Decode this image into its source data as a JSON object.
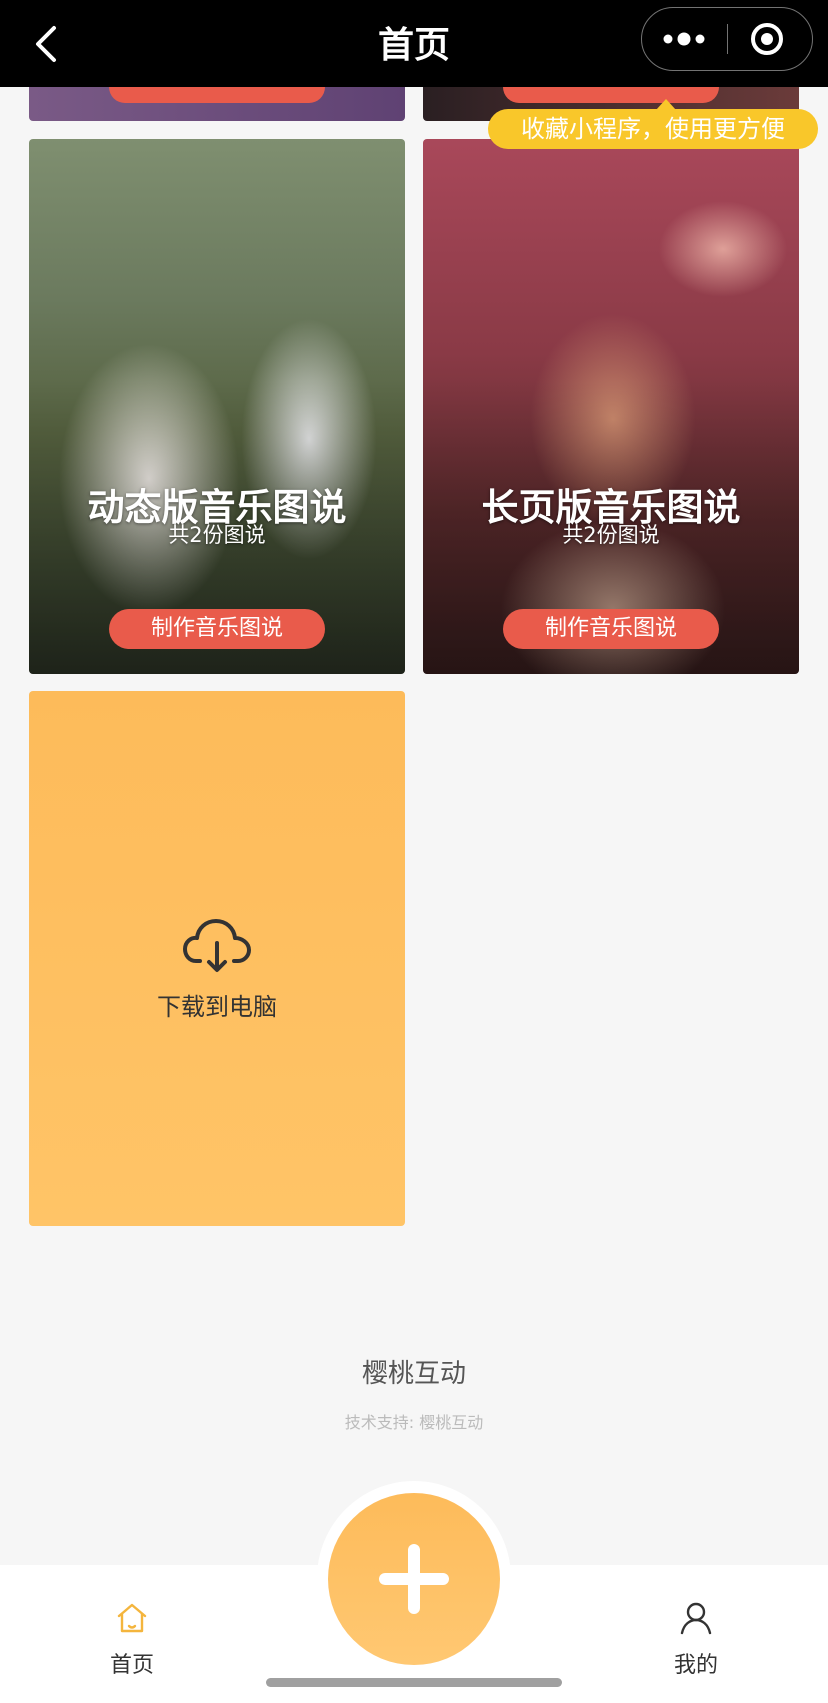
{
  "navbar": {
    "title": "首页",
    "back_icon": "chevron-left-icon",
    "more_icon": "three-dots-icon",
    "close_icon": "target-circle-icon"
  },
  "favorite_tip": "收藏小程序，使用更方便",
  "cards": [
    {
      "title": "动态版音乐图说",
      "subtitle": "共2份图说",
      "button": "制作音乐图说"
    },
    {
      "title": "长页版音乐图说",
      "subtitle": "共2份图说",
      "button": "制作音乐图说"
    }
  ],
  "download": {
    "icon": "cloud-download-icon",
    "label": "下载到电脑"
  },
  "footer": {
    "brand": "樱桃互动",
    "support": "技术支持: 樱桃互动"
  },
  "tabbar": {
    "home_label": "首页",
    "mine_label": "我的",
    "add_icon": "plus-icon"
  },
  "colors": {
    "accent": "#fdbb5a",
    "button_red": "#e95b4b",
    "tip_yellow": "#f9c72a"
  }
}
